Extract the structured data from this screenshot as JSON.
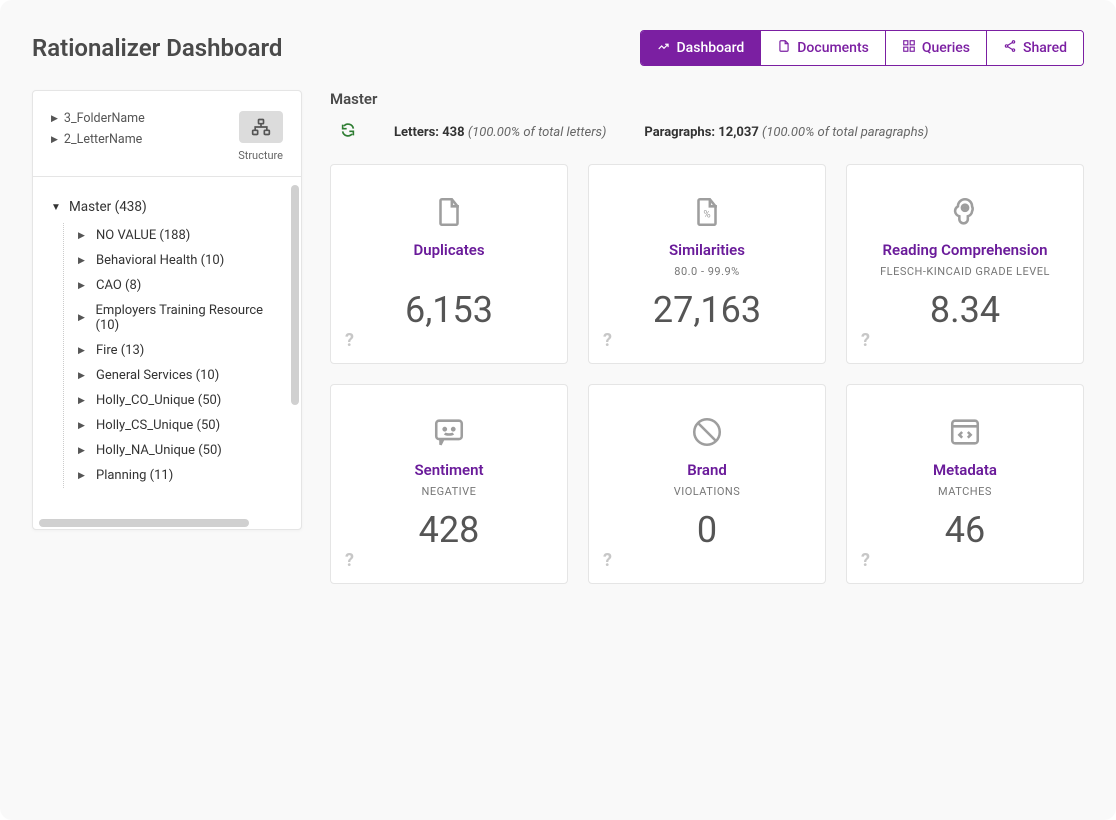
{
  "header": {
    "title": "Rationalizer Dashboard",
    "tabs": [
      {
        "label": "Dashboard",
        "active": true
      },
      {
        "label": "Documents",
        "active": false
      },
      {
        "label": "Queries",
        "active": false
      },
      {
        "label": "Shared",
        "active": false
      }
    ]
  },
  "sidebar": {
    "breadcrumbs": [
      {
        "label": "3_FolderName"
      },
      {
        "label": "2_LetterName"
      }
    ],
    "structure_label": "Structure",
    "tree": {
      "root_label": "Master (438)",
      "children": [
        {
          "label": "NO VALUE (188)"
        },
        {
          "label": "Behavioral Health (10)"
        },
        {
          "label": "CAO (8)"
        },
        {
          "label": "Employers Training Resource (10)"
        },
        {
          "label": "Fire (13)"
        },
        {
          "label": "General Services (10)"
        },
        {
          "label": "Holly_CO_Unique (50)"
        },
        {
          "label": "Holly_CS_Unique (50)"
        },
        {
          "label": "Holly_NA_Unique (50)"
        },
        {
          "label": "Planning (11)"
        }
      ]
    }
  },
  "main": {
    "section_title": "Master",
    "letters_label": "Letters:",
    "letters_count": "438",
    "letters_pct": "(100.00% of total letters)",
    "paragraphs_label": "Paragraphs:",
    "paragraphs_count": "12,037",
    "paragraphs_pct": "(100.00% of total paragraphs)",
    "cards": [
      {
        "title": "Duplicates",
        "sub": "",
        "value": "6,153",
        "icon": "file"
      },
      {
        "title": "Similarities",
        "sub": "80.0 - 99.9%",
        "value": "27,163",
        "icon": "file-percent"
      },
      {
        "title": "Reading Comprehension",
        "sub": "FLESCH-KINCAID GRADE LEVEL",
        "value": "8.34",
        "icon": "brain"
      },
      {
        "title": "Sentiment",
        "sub": "NEGATIVE",
        "value": "428",
        "icon": "chat"
      },
      {
        "title": "Brand",
        "sub": "VIOLATIONS",
        "value": "0",
        "icon": "ban"
      },
      {
        "title": "Metadata",
        "sub": "MATCHES",
        "value": "46",
        "icon": "window-code"
      }
    ],
    "help": "?"
  }
}
